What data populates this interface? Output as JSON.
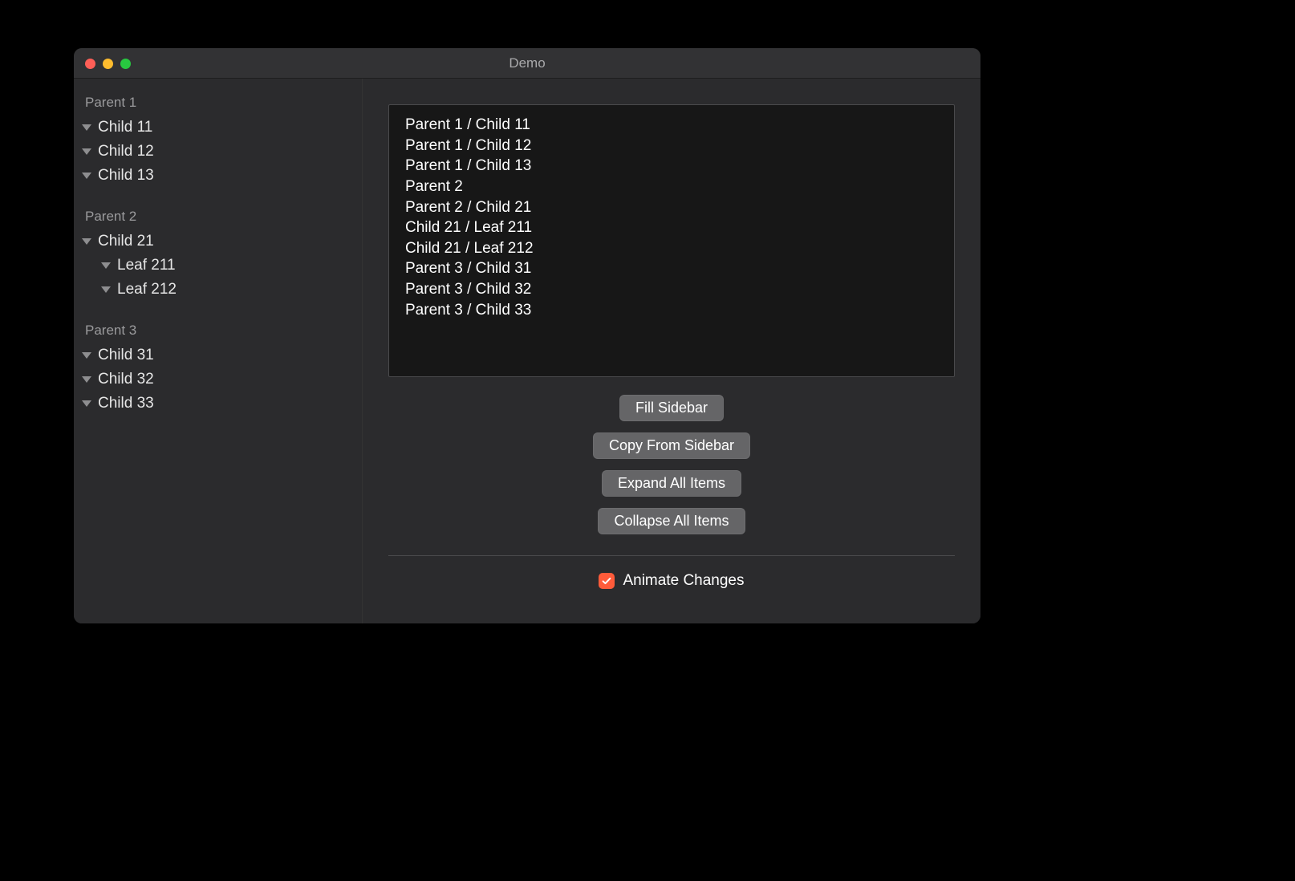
{
  "window": {
    "title": "Demo"
  },
  "sidebar": {
    "groups": [
      {
        "header": "Parent 1",
        "rows": [
          {
            "label": "Child 11",
            "indent": 0
          },
          {
            "label": "Child 12",
            "indent": 0
          },
          {
            "label": "Child 13",
            "indent": 0
          }
        ]
      },
      {
        "header": "Parent 2",
        "rows": [
          {
            "label": "Child 21",
            "indent": 0
          },
          {
            "label": "Leaf 211",
            "indent": 1
          },
          {
            "label": "Leaf 212",
            "indent": 1
          }
        ]
      },
      {
        "header": "Parent 3",
        "rows": [
          {
            "label": "Child 31",
            "indent": 0
          },
          {
            "label": "Child 32",
            "indent": 0
          },
          {
            "label": "Child 33",
            "indent": 0
          }
        ]
      }
    ]
  },
  "textview": {
    "lines": [
      "Parent 1 / Child 11",
      "Parent 1 / Child 12",
      "Parent 1 / Child 13",
      "Parent 2",
      "Parent 2 / Child 21",
      "Child 21 / Leaf 211",
      "Child 21 / Leaf 212",
      "Parent 3 / Child 31",
      "Parent 3 / Child 32",
      "Parent 3 / Child 33"
    ]
  },
  "buttons": {
    "fill": "Fill Sidebar",
    "copy": "Copy From Sidebar",
    "expand": "Expand All Items",
    "collapse": "Collapse All Items"
  },
  "checkbox": {
    "label": "Animate Changes",
    "checked": true
  }
}
